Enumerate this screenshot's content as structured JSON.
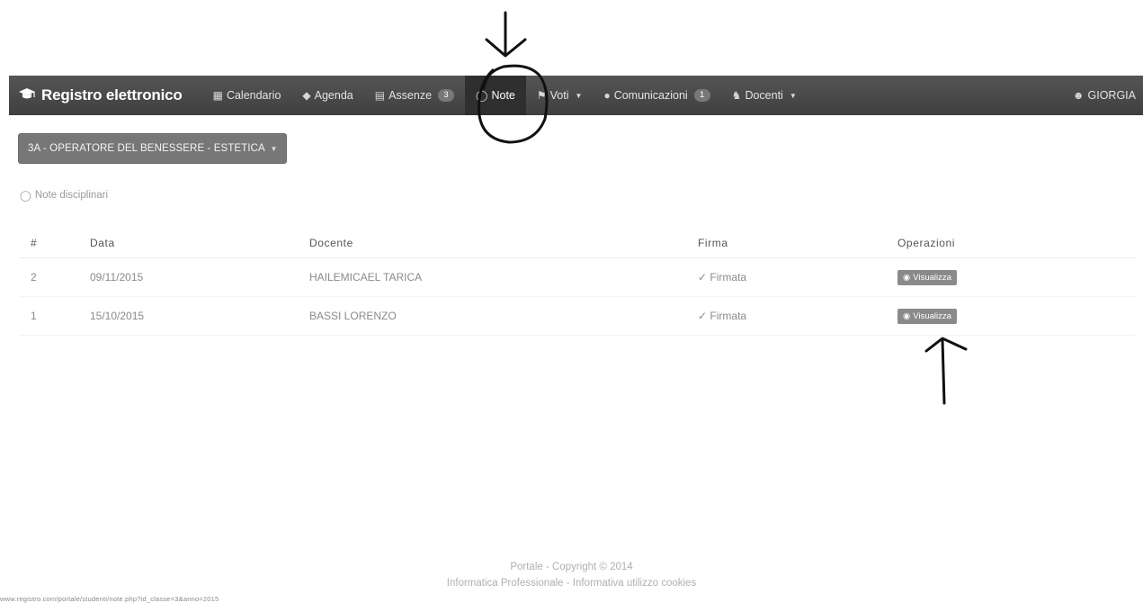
{
  "navbar": {
    "brand": "Registro elettronico",
    "items": [
      {
        "label": "Calendario",
        "icon": "calendar-icon"
      },
      {
        "label": "Agenda",
        "icon": "tag-icon"
      },
      {
        "label": "Assenze",
        "icon": "table-icon",
        "badge": "3"
      },
      {
        "label": "Note",
        "icon": "comment-icon",
        "active": true
      },
      {
        "label": "Voti",
        "icon": "flag-icon",
        "dropdown": true
      },
      {
        "label": "Comunicazioni",
        "icon": "speech-bubble-icon",
        "badge": "1"
      },
      {
        "label": "Docenti",
        "icon": "teacher-icon",
        "dropdown": true
      }
    ],
    "user": "GIORGIA"
  },
  "class_selector": {
    "label": "3A - OPERATORE DEL BENESSERE - ESTETICA"
  },
  "section": {
    "title": "Note disciplinari"
  },
  "table": {
    "headers": [
      "#",
      "Data",
      "Docente",
      "Firma",
      "Operazioni"
    ],
    "rows": [
      {
        "num": "2",
        "data": "09/11/2015",
        "docente": "HAILEMICAEL TARICA",
        "firma": "Firmata",
        "action": "Visualizza"
      },
      {
        "num": "1",
        "data": "15/10/2015",
        "docente": "BASSI LORENZO",
        "firma": "Firmata",
        "action": "Visualizza"
      }
    ]
  },
  "footer": {
    "copyright": "Portale - Copyright © 2014",
    "links": "Informatica Professionale - Informativa utilizzo cookies"
  },
  "status_bar": {
    "url": "www.registro.com/portale/studenti/note.php?id_classe=3&anno=2015"
  }
}
